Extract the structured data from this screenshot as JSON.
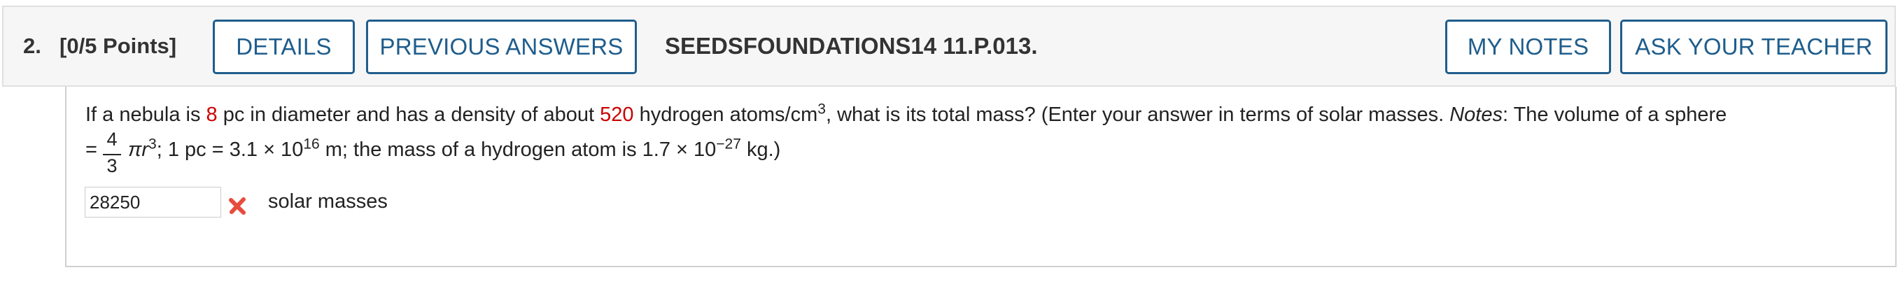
{
  "header": {
    "question_number": "2.",
    "points": "[0/5 Points]",
    "details_label": "DETAILS",
    "previous_answers_label": "PREVIOUS ANSWERS",
    "question_code": "SEEDSFOUNDATIONS14 11.P.013.",
    "my_notes_label": "MY NOTES",
    "ask_teacher_label": "ASK YOUR TEACHER"
  },
  "question": {
    "part1": "If a nebula is ",
    "diameter_value": "8",
    "part2": " pc in diameter and has a density of about ",
    "density_value": "520",
    "part3": " hydrogen atoms/cm",
    "part3_sup": "3",
    "part4": ", what is its total mass? (Enter your answer in terms of solar masses. ",
    "notes_label": "Notes",
    "part5": ": The volume of a sphere",
    "equals": "=",
    "frac_num": "4",
    "frac_den": "3",
    "formula_rest": "πr",
    "formula_sup": "3",
    "part6": "; 1 pc = 3.1 × 10",
    "pc_exp": "16",
    "part7": " m; the mass of a hydrogen atom is 1.7 × 10",
    "h_exp": "−27",
    "part8": " kg.)"
  },
  "answer": {
    "value": "28250",
    "status_icon": "x-mark-icon",
    "unit": "solar masses"
  },
  "colors": {
    "accent": "#1f5d8c",
    "highlight": "#cc0000",
    "incorrect": "#e74c3c"
  }
}
